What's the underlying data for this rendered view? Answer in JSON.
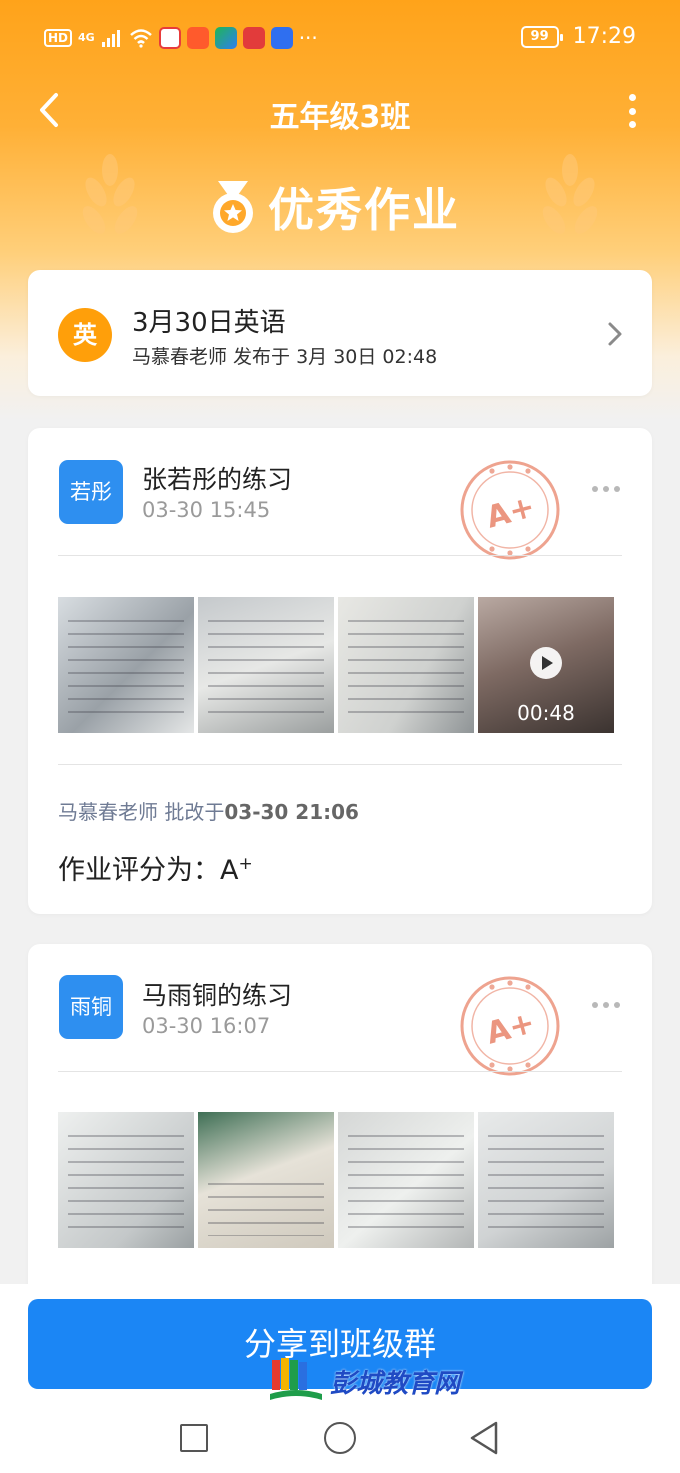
{
  "status_bar": {
    "network": "HD",
    "signal": "4G",
    "battery": "99",
    "time": "17:29",
    "more": "···"
  },
  "header": {
    "title": "五年级3班"
  },
  "banner": {
    "title": "优秀作业"
  },
  "homework": {
    "subject_badge": "英",
    "title": "3月30日英语",
    "meta": "马慕春老师 发布于 3月 30日 02:48"
  },
  "submissions": [
    {
      "avatar_text": "若彤",
      "title": "张若彤的练习",
      "time": "03-30 15:45",
      "stamp": "A+",
      "video_duration": "00:48",
      "grader": "马慕春老师",
      "graded_prefix": "批改于",
      "graded_time": "03-30 21:06",
      "score_label": "作业评分为：",
      "score": "A",
      "score_sup": "+"
    },
    {
      "avatar_text": "雨铜",
      "title": "马雨铜的练习",
      "time": "03-30 16:07",
      "stamp": "A+"
    }
  ],
  "share_button": "分享到班级群",
  "watermark": "彭城教育网",
  "colors": {
    "accent_orange": "#ff9f0a",
    "primary_blue": "#1b86f5",
    "avatar_blue": "#2e8ff0",
    "stamp_red": "#e8846a"
  }
}
